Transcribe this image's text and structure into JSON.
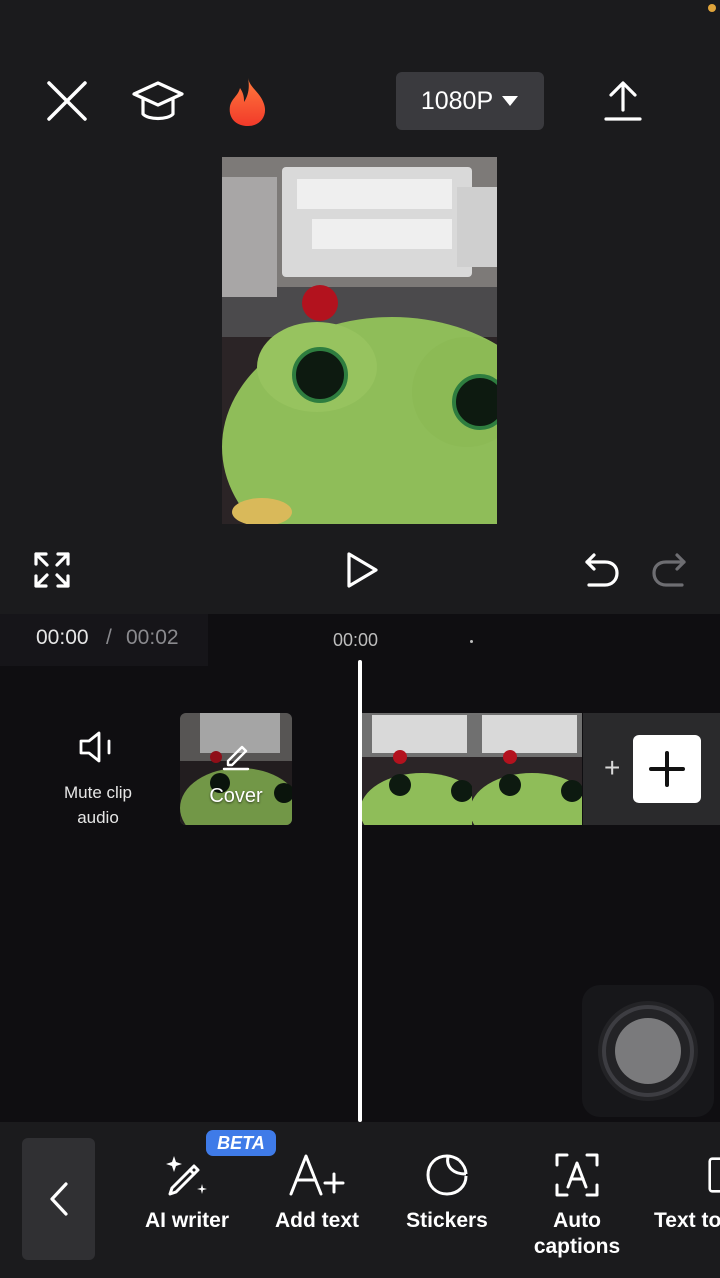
{
  "header": {
    "resolution_label": "1080P"
  },
  "playback": {
    "current_time": "00:00",
    "separator": "/",
    "total_time": "00:02",
    "ruler_label": "00:00"
  },
  "track": {
    "mute_label_line1": "Mute clip",
    "mute_label_line2": "audio",
    "cover_label": "Cover",
    "add_button_text": "+"
  },
  "toolbar": {
    "items": [
      {
        "label": "AI writer",
        "icon": "ai-writer-icon",
        "badge": "BETA"
      },
      {
        "label": "Add text",
        "icon": "add-text-icon"
      },
      {
        "label": "Stickers",
        "icon": "stickers-icon"
      },
      {
        "label_line1": "Auto",
        "label_line2": "captions",
        "icon": "auto-captions-icon"
      },
      {
        "label": "Text to",
        "icon": "text-to-icon"
      }
    ]
  },
  "colors": {
    "background": "#1b1b1d",
    "timeline_background": "#0f0e11",
    "accent_flame": "#ff4d2e",
    "beta_badge": "#3f7be8",
    "playhead": "#ffffff"
  }
}
